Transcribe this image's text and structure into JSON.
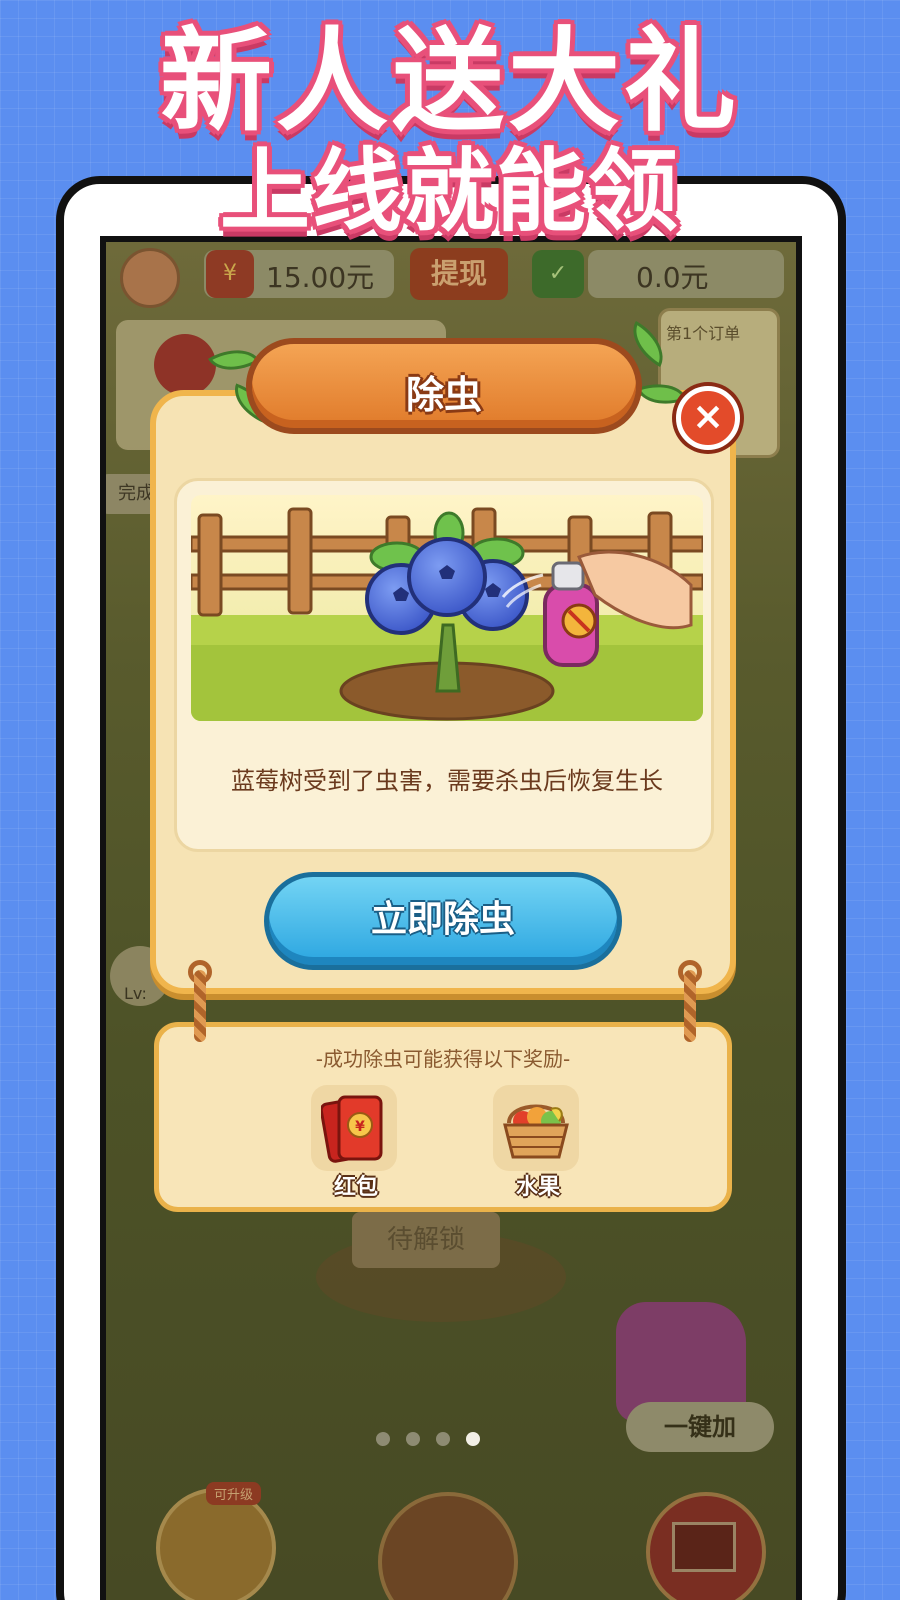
{
  "promo": {
    "line1": "新人送大礼",
    "line2": "上线就能领"
  },
  "hud": {
    "coin_icon": "¥",
    "coin_balance": "15.00元",
    "withdraw_label": "提现",
    "wallet_icon": "✓",
    "wallet_balance": "0.0元",
    "order_label": "第1个订单",
    "side_tag": "完成",
    "level_label": "Lv:",
    "sign_label": "待解锁",
    "onekey_label": "一键加",
    "upgrade_tag": "可升级"
  },
  "modal": {
    "title": "除虫",
    "close_icon": "×",
    "description": "蓝莓树受到了虫害，需要杀虫后恢复生长",
    "action_label": "立即除虫"
  },
  "rewards": {
    "title": "-成功除虫可能获得以下奖励-",
    "items": [
      {
        "label": "红包",
        "icon": "red-envelope-icon"
      },
      {
        "label": "水果",
        "icon": "fruit-basket-icon"
      }
    ]
  },
  "pagination": {
    "count": 4,
    "active_index": 3
  },
  "colors": {
    "background": "#5b8ef0",
    "promo_stroke": "#e8507a",
    "modal_fill": "#f6e3b4",
    "primary_button": "#2aa5e0",
    "title_banner": "#e07a2a"
  }
}
